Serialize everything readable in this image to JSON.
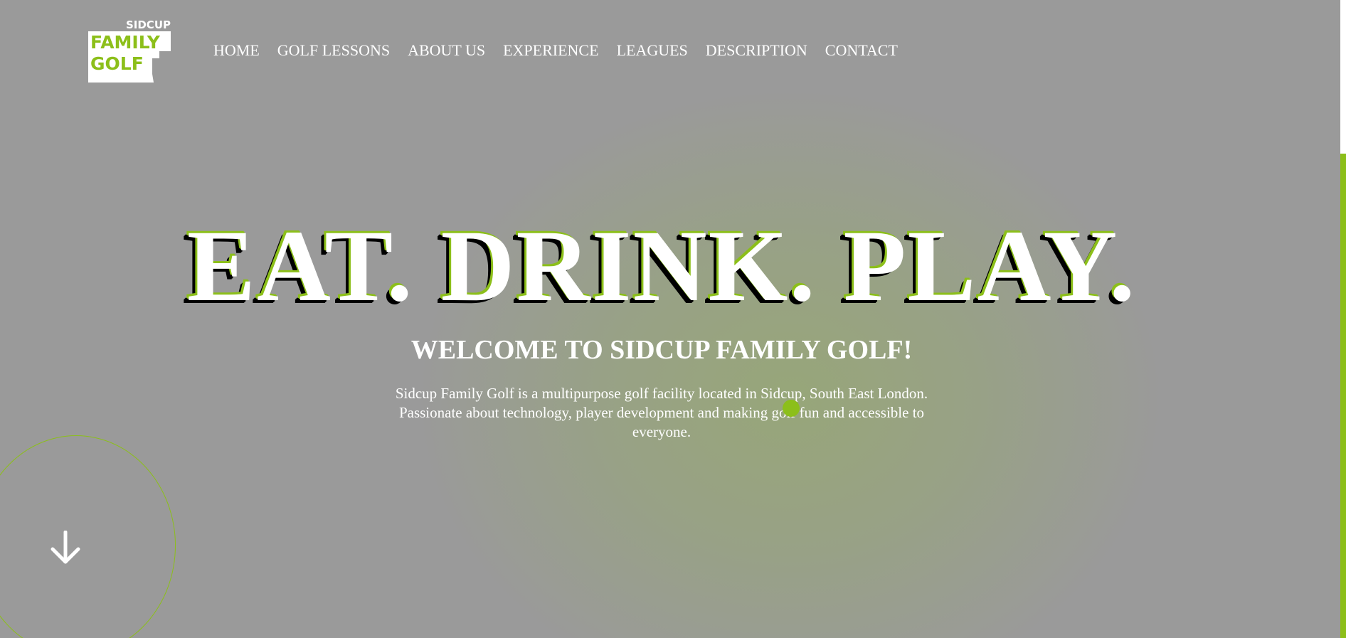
{
  "brand": {
    "logo_top": "SIDCUP",
    "logo_mid": "FAMILY",
    "logo_bottom": "GOLF",
    "accent_color": "#8cbf1a",
    "background_color": "#9a9a9a"
  },
  "nav": {
    "items": [
      {
        "label": "HOME"
      },
      {
        "label": "GOLF LESSONS"
      },
      {
        "label": "ABOUT US"
      },
      {
        "label": "EXPERIENCE"
      },
      {
        "label": "LEAGUES"
      },
      {
        "label": "DESCRIPTION"
      },
      {
        "label": "CONTACT"
      }
    ]
  },
  "hero": {
    "title": "EAT. DRINK. PLAY.",
    "subtitle": "WELCOME TO SIDCUP FAMILY GOLF!",
    "description": "Sidcup Family Golf is a multipurpose golf facility located in Sidcup, South East London. Passionate about technology, player development and making golf fun and accessible to everyone."
  },
  "icons": {
    "scroll_down": "arrow-down-icon"
  }
}
